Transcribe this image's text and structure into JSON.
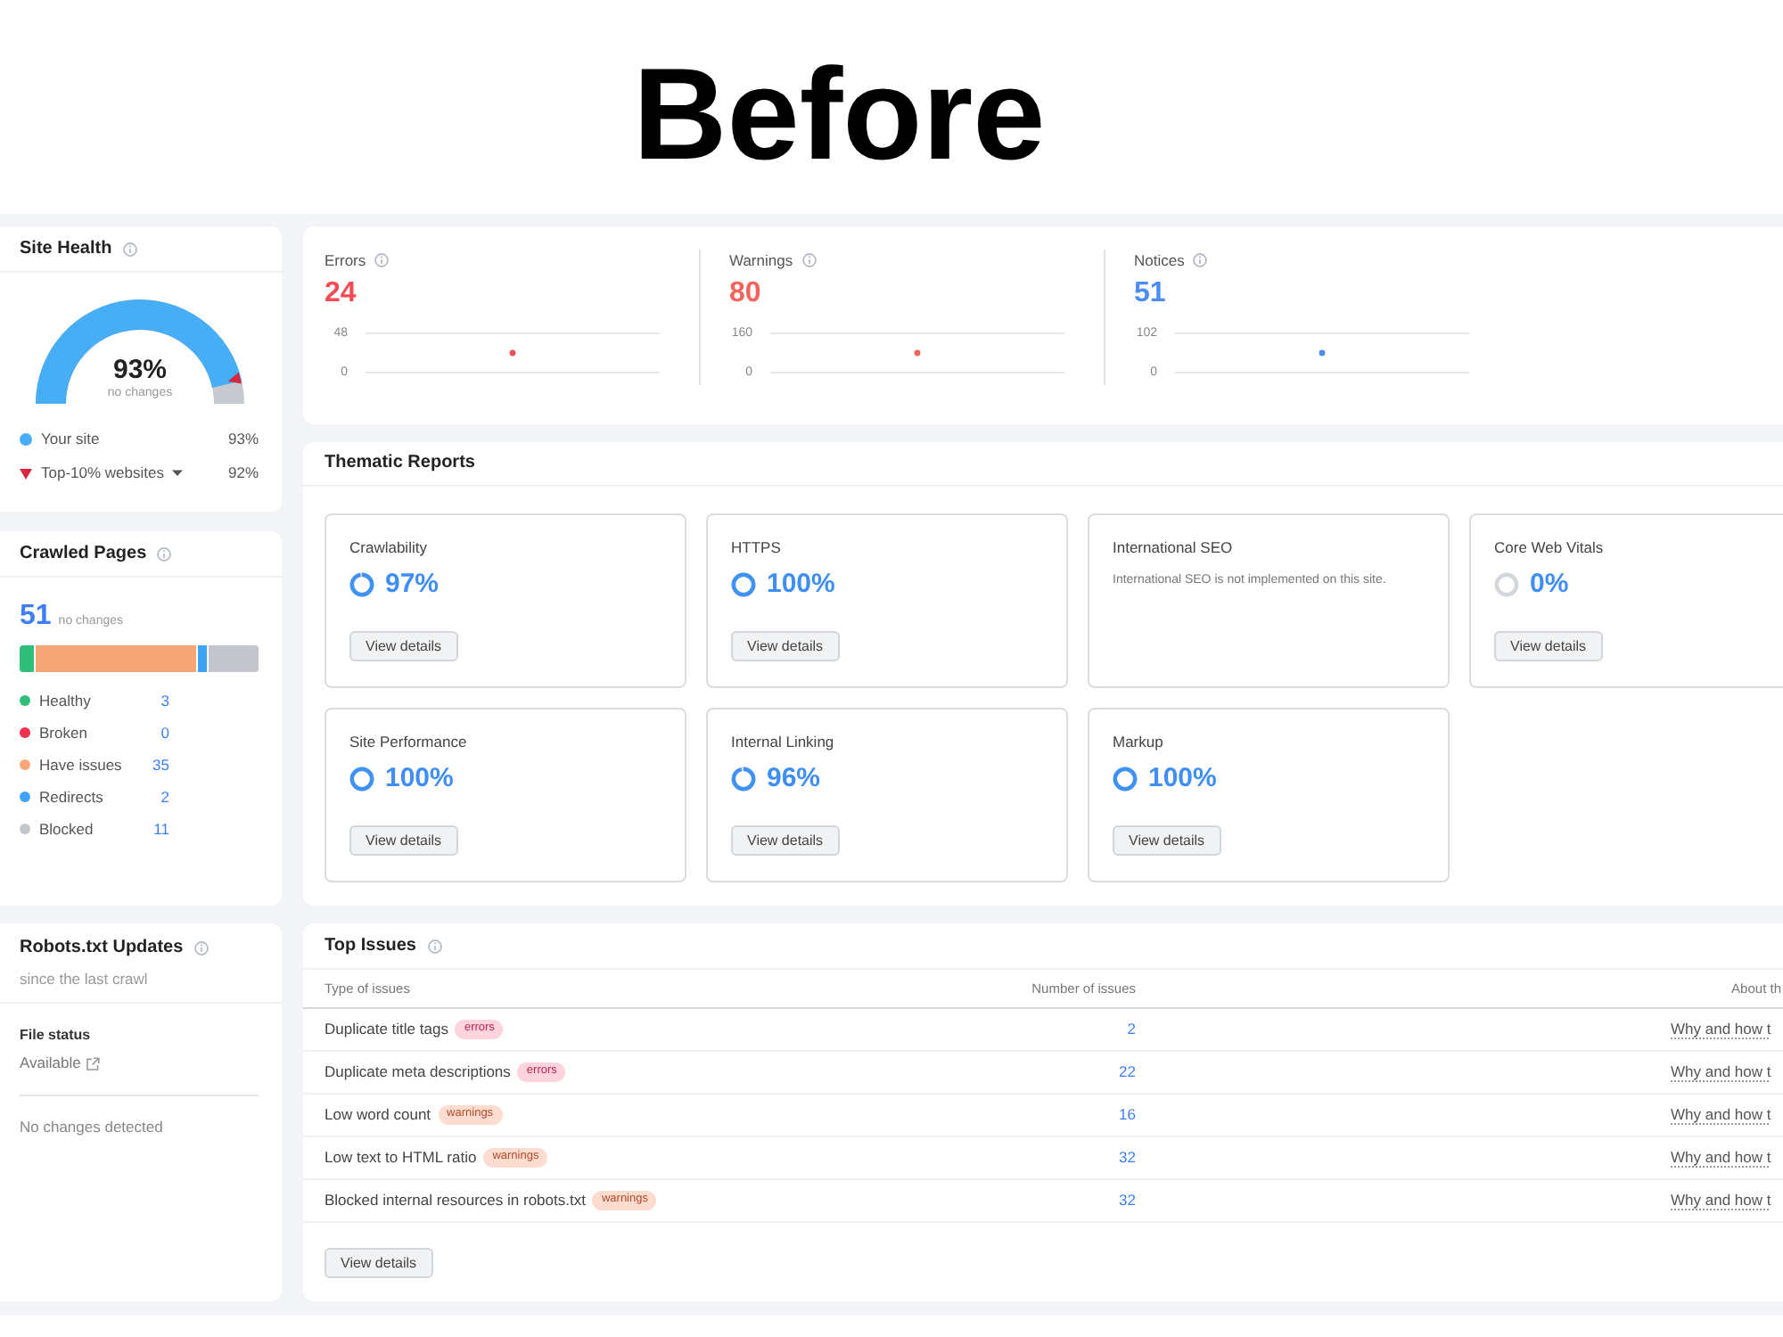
{
  "title": "Before",
  "site_health": {
    "title": "Site Health",
    "score": "93%",
    "note": "no changes",
    "legend": [
      {
        "kind": "dot",
        "label": "Your site",
        "value": "93%",
        "color": "#47adf5"
      },
      {
        "kind": "marker",
        "label": "Top-10% websites",
        "value": "92%",
        "color": "#d7263d"
      }
    ]
  },
  "crawled_pages": {
    "title": "Crawled Pages",
    "total": "51",
    "note": "no changes",
    "categories": [
      {
        "label": "Healthy",
        "value": "3",
        "color": "#2fbf7a"
      },
      {
        "label": "Broken",
        "value": "0",
        "color": "#f0304f"
      },
      {
        "label": "Have issues",
        "value": "35",
        "color": "#f6a677"
      },
      {
        "label": "Redirects",
        "value": "2",
        "color": "#3ea3f5"
      },
      {
        "label": "Blocked",
        "value": "11",
        "color": "#c3c7cd"
      }
    ]
  },
  "robots": {
    "title": "Robots.txt Updates",
    "subtitle": "since the last crawl",
    "file_status_label": "File status",
    "file_status": "Available",
    "message": "No changes detected"
  },
  "metrics": [
    {
      "label": "Errors",
      "value": "24",
      "color": "#f24c57",
      "chart_data": {
        "type": "scatter",
        "values": [
          24
        ],
        "ylim": [
          0,
          48
        ],
        "yticks": [
          0,
          48
        ]
      }
    },
    {
      "label": "Warnings",
      "value": "80",
      "color": "#f4645a",
      "chart_data": {
        "type": "scatter",
        "values": [
          80
        ],
        "ylim": [
          0,
          160
        ],
        "yticks": [
          0,
          160
        ]
      }
    },
    {
      "label": "Notices",
      "value": "51",
      "color": "#4a8ef2",
      "chart_data": {
        "type": "scatter",
        "values": [
          51
        ],
        "ylim": [
          0,
          102
        ],
        "yticks": [
          0,
          102
        ]
      }
    }
  ],
  "thematic_reports": {
    "title": "Thematic Reports",
    "reports": [
      {
        "kind": "score",
        "name": "Crawlability",
        "score": "97%",
        "button": "View details"
      },
      {
        "kind": "score",
        "name": "HTTPS",
        "score": "100%",
        "button": "View details"
      },
      {
        "kind": "note",
        "name": "International SEO",
        "description": "International SEO is not implemented on this site."
      },
      {
        "kind": "score",
        "name": "Core Web Vitals",
        "score": "0%",
        "button": "View details"
      },
      {
        "kind": "score",
        "name": "Site Performance",
        "score": "100%",
        "button": "View details"
      },
      {
        "kind": "score",
        "name": "Internal Linking",
        "score": "96%",
        "button": "View details"
      },
      {
        "kind": "score",
        "name": "Markup",
        "score": "100%",
        "button": "View details"
      }
    ]
  },
  "top_issues": {
    "title": "Top Issues",
    "columns": [
      "Type of issues",
      "Number of issues",
      "About th"
    ],
    "rows": [
      {
        "issue": "Duplicate title tags",
        "tag": {
          "label": "errors",
          "kind": "error"
        },
        "count": "2",
        "link": "Why and how t"
      },
      {
        "issue": "Duplicate meta descriptions",
        "tag": {
          "label": "errors",
          "kind": "error"
        },
        "count": "22",
        "link": "Why and how t"
      },
      {
        "issue": "Low word count",
        "tag": {
          "label": "warnings",
          "kind": "warning"
        },
        "count": "16",
        "link": "Why and how t"
      },
      {
        "issue": "Low text to HTML ratio",
        "tag": {
          "label": "warnings",
          "kind": "warning"
        },
        "count": "32",
        "link": "Why and how t"
      },
      {
        "issue": "Blocked internal resources in robots.txt",
        "tag": {
          "label": "warnings",
          "kind": "warning"
        },
        "count": "32",
        "link": "Why and how t"
      }
    ],
    "button": "View details"
  }
}
